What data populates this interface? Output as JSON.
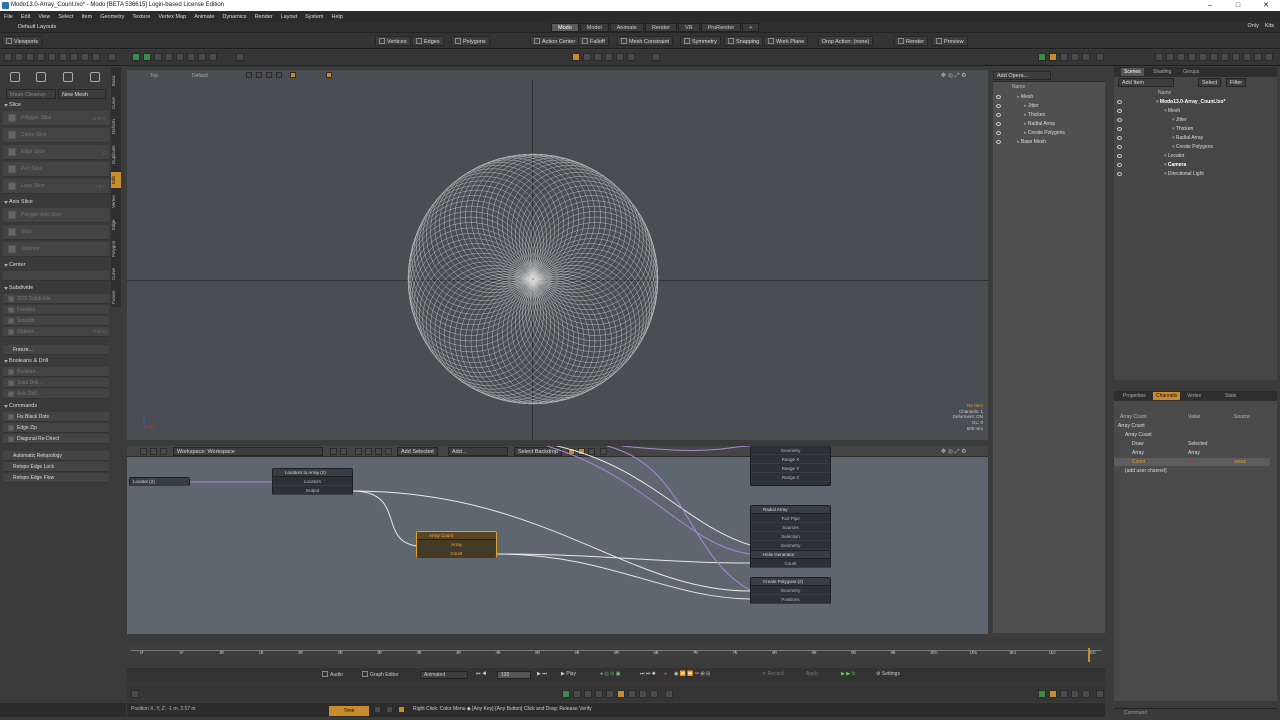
{
  "window": {
    "title": "Modo13.0-Array_Count.lxo* - Modo [BETA 536615] Login-based License Edition",
    "controls": [
      "–",
      "□",
      "✕"
    ]
  },
  "menu": [
    "File",
    "Edit",
    "View",
    "Select",
    "Item",
    "Geometry",
    "Texture",
    "Vertex Map",
    "Animate",
    "Dynamics",
    "Render",
    "Layout",
    "System",
    "Help"
  ],
  "layouts": {
    "label": "Default Layouts",
    "tabs": [
      "Modo",
      "Model",
      "Animate",
      "Render",
      "VR",
      "ProRender",
      "+"
    ],
    "right": [
      "Only",
      "Kits"
    ]
  },
  "toolbar": {
    "viewports_label": "Viewports",
    "vertices": "Vertices",
    "edges": "Edges",
    "polygons": "Polygons",
    "action_center": "Action Center",
    "falloff": "Falloff",
    "mesh_constraint": "Mesh Constraint",
    "symmetry": "Symmetry",
    "snapping": "Snapping",
    "work_plane": "Work Plane",
    "drop_action": "Drop Action: (none)",
    "render": "Render",
    "preview": "Preview"
  },
  "left_panel": {
    "mesh_cleanup": "Mesh Cleanup",
    "new_mesh": "New Mesh",
    "sections": {
      "slice": "Slice",
      "axis_slice": "Axis Slice",
      "center": "Center",
      "subdivide": "Subdivide",
      "booleans": "Booleans & Drill",
      "commands": "Commands"
    },
    "slice_items": [
      {
        "label": "Polygon Slice",
        "shortcut": "Shift-C"
      },
      {
        "label": "Curve Slice",
        "shortcut": ""
      },
      {
        "label": "Edge Slice",
        "shortcut": "C"
      },
      {
        "label": "Pen Slice",
        "shortcut": ""
      },
      {
        "label": "Loop Slice",
        "shortcut": "Alt-C"
      }
    ],
    "axis_items": [
      "Polygon Axis Slice",
      "Slice",
      "Julienne"
    ],
    "subdivide_items": [
      {
        "label": "SDS Subdivide",
        "shortcut": ""
      },
      {
        "label": "Faceted",
        "shortcut": ""
      },
      {
        "label": "Smooth",
        "shortcut": ""
      },
      {
        "label": "Options...",
        "shortcut": "Shift-D"
      }
    ],
    "freeze": "Freeze...",
    "boolean_items": [
      "Boolean...",
      "Solid Drill...",
      "Axis Drill..."
    ],
    "command_items": [
      "Fix Black Dots",
      "Edge Zip",
      "Diagonal Re-Direct"
    ],
    "retopo_items": [
      "Automatic Retopology",
      "Retopo Edge Lock",
      "Retopo Edge Flow"
    ],
    "vtabs": [
      "Basic",
      "Curve",
      "Deform",
      "Duplicate",
      "Edit",
      "Vertex",
      "Edge",
      "Polygon",
      "Curve",
      "Fusion"
    ]
  },
  "viewport": {
    "view_label": "Top",
    "style_label": "Default",
    "info": {
      "no_item": "No Item",
      "channels": "Channels: 1",
      "deformers": "Deformers: ON",
      "gl": "GL: 0",
      "size": "500 mm"
    }
  },
  "node_editor": {
    "workspace": "Workspace: Workspace",
    "add_selected": "Add Selected",
    "add": "Add...",
    "select_backdrop": "Select Backdrop",
    "nodes": {
      "locator": {
        "title": "Locator (2)"
      },
      "loc_to_array": {
        "title": "Locators to Array (2)",
        "ports": [
          "Locators",
          "Output"
        ]
      },
      "array_count": {
        "title": "Array Count",
        "ports": [
          "Array",
          "Count"
        ]
      },
      "range_node": {
        "ports": [
          "Geometry",
          "Range X",
          "Range Y",
          "Range Z"
        ]
      },
      "radial_array": {
        "title": "Radial Array",
        "ports": [
          "Tool Pipe",
          "Sources",
          "Selection",
          "Geometry"
        ]
      },
      "helix_gen": {
        "title": "Helix Generator",
        "ports": [
          "Count"
        ]
      },
      "create_polys": {
        "title": "Create Polygons (2)",
        "ports": [
          "Geometry",
          "Positions"
        ]
      }
    }
  },
  "items_panel": {
    "add_operator": "Add Opera...",
    "header_name": "Name",
    "items": [
      {
        "label": "Mesh",
        "indent": 1
      },
      {
        "label": "Jitter",
        "indent": 2
      },
      {
        "label": "Thicken",
        "indent": 2
      },
      {
        "label": "Radial Array",
        "indent": 2
      },
      {
        "label": "Create Polygons",
        "indent": 2
      },
      {
        "label": "Base Mesh",
        "indent": 1
      }
    ]
  },
  "scenes_panel": {
    "tabs": [
      "Scenes",
      "Shading",
      "Groups"
    ],
    "add_item": "Add Item",
    "select": "Select",
    "filter": "Filter",
    "header_name": "Name",
    "tree": [
      {
        "label": "Modo13.0-Array_Count.lxo*",
        "indent": 0,
        "bold": true
      },
      {
        "label": "Mesh",
        "indent": 1,
        "bold": false
      },
      {
        "label": "Jitter",
        "indent": 2,
        "bold": false
      },
      {
        "label": "Thicken",
        "indent": 2,
        "bold": false
      },
      {
        "label": "Radial Array",
        "indent": 2,
        "bold": false
      },
      {
        "label": "Create Polygons",
        "indent": 2,
        "bold": false
      },
      {
        "label": "Locator",
        "indent": 1,
        "bold": false
      },
      {
        "label": "Camera",
        "indent": 1,
        "bold": true
      },
      {
        "label": "Directional Light",
        "indent": 1,
        "bold": false
      }
    ]
  },
  "properties_panel": {
    "tabs": [
      "Properties",
      "Channels",
      "Vertex",
      "Stats"
    ],
    "headers": [
      "Array Count",
      "Value",
      "Source"
    ],
    "rows": [
      {
        "label": "Array Count",
        "value": "",
        "source": "",
        "indent": 0
      },
      {
        "label": "Array Count",
        "value": "",
        "source": "",
        "indent": 1
      },
      {
        "label": "Draw",
        "value": "Selected",
        "source": "",
        "indent": 2
      },
      {
        "label": "Array",
        "value": "Array",
        "source": "",
        "indent": 2
      },
      {
        "label": "Count",
        "value": "121",
        "source": "setup",
        "indent": 2
      },
      {
        "label": "(add user channel)",
        "value": "",
        "source": "",
        "indent": 1
      }
    ]
  },
  "timeline": {
    "ticks": [
      "0",
      "5",
      "10",
      "15",
      "20",
      "25",
      "30",
      "35",
      "40",
      "45",
      "50",
      "55",
      "60",
      "65",
      "70",
      "75",
      "80",
      "85",
      "90",
      "95",
      "100",
      "105",
      "110",
      "115",
      "120"
    ],
    "audio": "Audio",
    "graph_editor": "Graph Editor",
    "animated": "Animated",
    "frame": "120",
    "play": "Play",
    "record": "Record",
    "apply": "Apply",
    "settings": "Settings"
  },
  "status": {
    "position": "Position X, Y, Z:   -1 m,  2.57 m",
    "time": "Time",
    "hint": "Right Click: Color Menu  ◆  [Any Key]-[Any Button] Click and Drag: Release Verify",
    "command": "Command"
  },
  "colors": {
    "accent": "#c98b2c",
    "viewport_bg": "#4a4e53",
    "node_bg": "#5e6670",
    "wire_white": "#e8e8e8",
    "wire_purple": "#a98ad6"
  }
}
